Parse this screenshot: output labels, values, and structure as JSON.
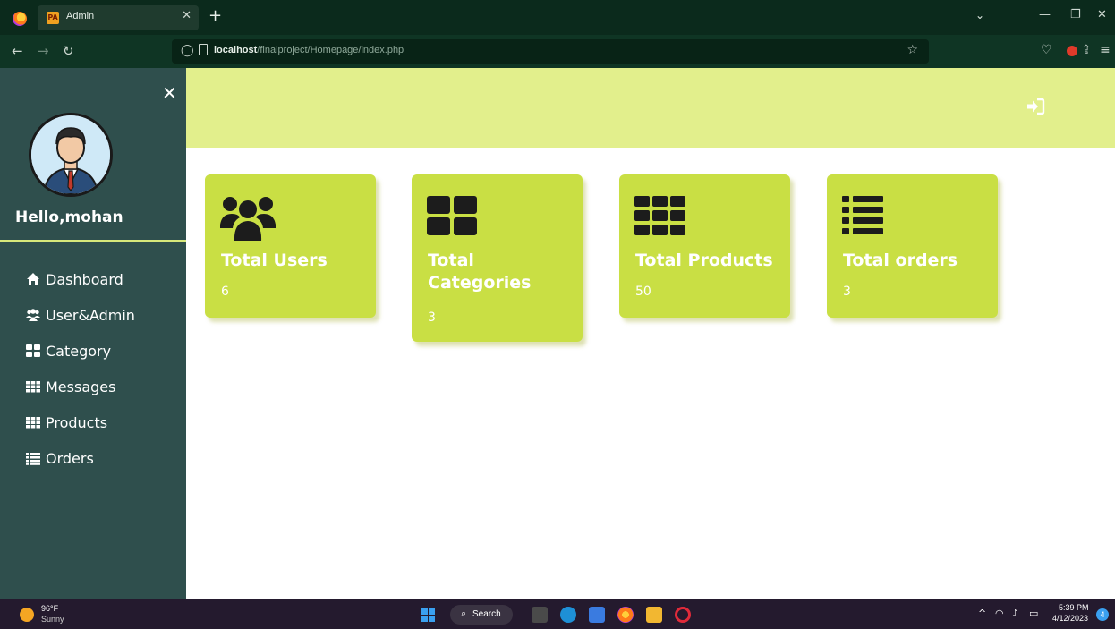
{
  "browser": {
    "tab_title": "Admin",
    "tab_favicon_text": "PA",
    "url_host": "localhost",
    "url_path": "/finalproject/Homepage/index.php"
  },
  "sidebar": {
    "greeting": "Hello,mohan",
    "items": [
      {
        "label": "Dashboard",
        "icon": "home-icon"
      },
      {
        "label": "User&Admin",
        "icon": "users-icon"
      },
      {
        "label": "Category",
        "icon": "th-large-icon"
      },
      {
        "label": "Messages",
        "icon": "th-icon"
      },
      {
        "label": "Products",
        "icon": "th-icon"
      },
      {
        "label": "Orders",
        "icon": "list-icon"
      }
    ]
  },
  "cards": [
    {
      "title": "Total Users",
      "value": "6",
      "icon": "users-icon"
    },
    {
      "title": "Total Categories",
      "value": "3",
      "icon": "th-large-icon"
    },
    {
      "title": "Total Products",
      "value": "50",
      "icon": "th-icon"
    },
    {
      "title": "Total orders",
      "value": "3",
      "icon": "list-icon"
    }
  ],
  "taskbar": {
    "weather_temp": "96°F",
    "weather_cond": "Sunny",
    "search_label": "Search",
    "time": "5:39 PM",
    "date": "4/12/2023",
    "notification_count": "4"
  },
  "colors": {
    "sidebar_bg": "#2f4f4d",
    "header_bg": "#e2ef8c",
    "card_bg": "#c9df44",
    "divider": "#d7e87a"
  }
}
